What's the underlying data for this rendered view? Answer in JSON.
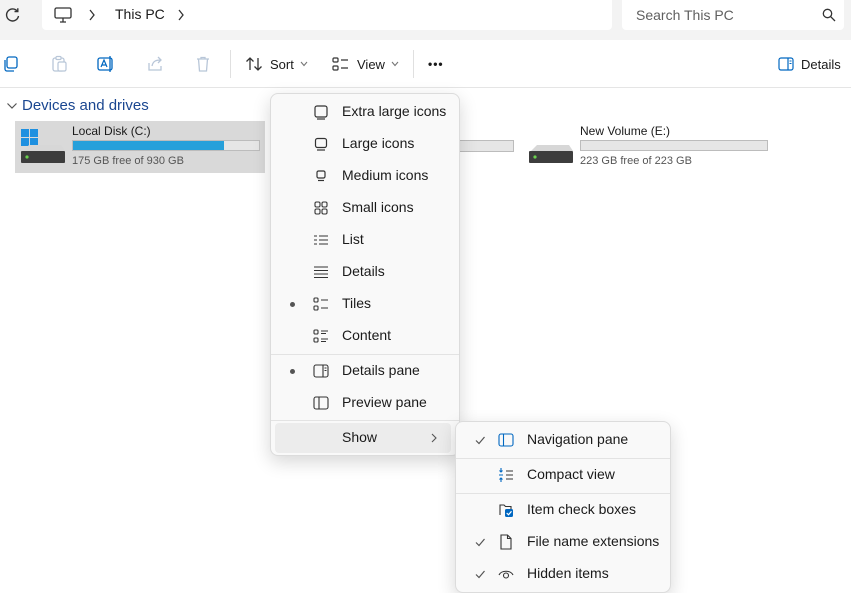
{
  "address": {
    "crumb": "This PC",
    "search_placeholder": "Search This PC"
  },
  "cmdbar": {
    "sort_label": "Sort",
    "view_label": "View",
    "more_label": "•••",
    "details_label": "Details"
  },
  "section": {
    "title": "Devices and drives"
  },
  "drives": [
    {
      "name": "Local Disk (C:)",
      "free_text": "175 GB free of 930 GB",
      "used_fraction": 0.81
    },
    {
      "name": "New Volume (E:)",
      "free_text": "223 GB free of 223 GB",
      "used_fraction": 0.0
    }
  ],
  "view_menu": {
    "items": [
      {
        "label": "Extra large icons",
        "icon": "extra-large-icons-icon",
        "selected": false
      },
      {
        "label": "Large icons",
        "icon": "large-icons-icon",
        "selected": false
      },
      {
        "label": "Medium icons",
        "icon": "medium-icons-icon",
        "selected": false
      },
      {
        "label": "Small icons",
        "icon": "small-icons-icon",
        "selected": false
      },
      {
        "label": "List",
        "icon": "list-icon",
        "selected": false
      },
      {
        "label": "Details",
        "icon": "details-icon",
        "selected": false
      },
      {
        "label": "Tiles",
        "icon": "tiles-icon",
        "selected": true
      },
      {
        "label": "Content",
        "icon": "content-icon",
        "selected": false
      }
    ],
    "pane_items": [
      {
        "label": "Details pane",
        "icon": "details-pane-icon",
        "selected": true
      },
      {
        "label": "Preview pane",
        "icon": "preview-pane-icon",
        "selected": false
      }
    ],
    "show_label": "Show"
  },
  "show_menu": {
    "items": [
      {
        "label": "Navigation pane",
        "icon": "navigation-pane-icon",
        "checked": true
      },
      {
        "label": "Compact view",
        "icon": "compact-view-icon",
        "checked": false
      },
      {
        "label": "Item check boxes",
        "icon": "item-check-boxes-icon",
        "checked": false
      },
      {
        "label": "File name extensions",
        "icon": "file-icon",
        "checked": true
      },
      {
        "label": "Hidden items",
        "icon": "eye-icon",
        "checked": true
      }
    ]
  },
  "colors": {
    "accent": "#26a0da",
    "section": "#1a4690",
    "checkbox": "#0067c0"
  }
}
